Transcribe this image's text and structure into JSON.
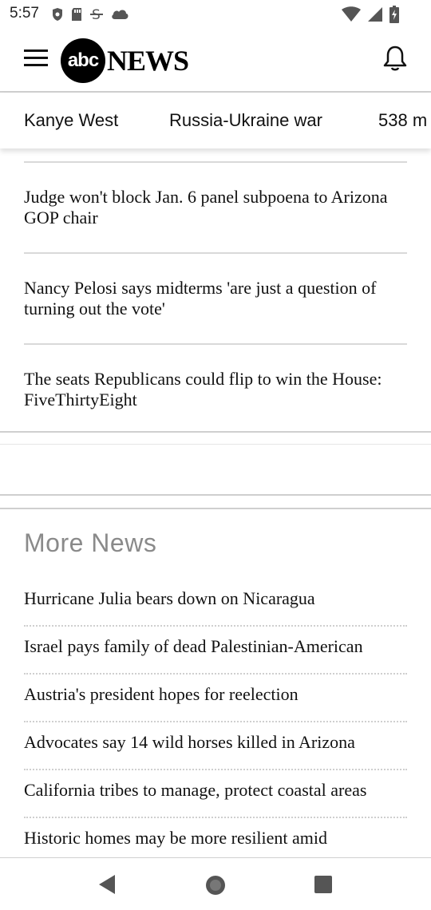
{
  "status_bar": {
    "time": "5:57",
    "left_icons": [
      "shield-icon",
      "sd-card-icon",
      "strike-s-icon",
      "cloud-icon"
    ],
    "right_icons": [
      "wifi-icon",
      "signal-icon",
      "battery-icon"
    ]
  },
  "header": {
    "logo_badge": "abc",
    "logo_word": "NEWS",
    "menu_icon": "hamburger-menu-icon",
    "bell_icon": "notification-bell-icon"
  },
  "topics": [
    {
      "label": "Kanye West"
    },
    {
      "label": "Russia-Ukraine war"
    },
    {
      "label": "538 m"
    }
  ],
  "stories": [
    {
      "title": "Judge won't block Jan. 6 panel subpoena to Arizona GOP chair"
    },
    {
      "title": "Nancy Pelosi says midterms 'are just a question of turning out the vote'"
    },
    {
      "title": "The seats Republicans could flip to win the House: FiveThirtyEight"
    }
  ],
  "more_news": {
    "title": "More News",
    "items": [
      {
        "title": "Hurricane Julia bears down on Nicaragua"
      },
      {
        "title": "Israel pays family of dead Palestinian-American"
      },
      {
        "title": "Austria's president hopes for reelection"
      },
      {
        "title": "Advocates say 14 wild horses killed in Arizona"
      },
      {
        "title": "California tribes to manage, protect coastal areas"
      },
      {
        "title": "Historic homes may be more resilient amid"
      }
    ]
  },
  "nav_bar": {
    "back_icon": "back-triangle-icon",
    "home_icon": "home-circle-icon",
    "recent_icon": "recent-apps-square-icon"
  }
}
